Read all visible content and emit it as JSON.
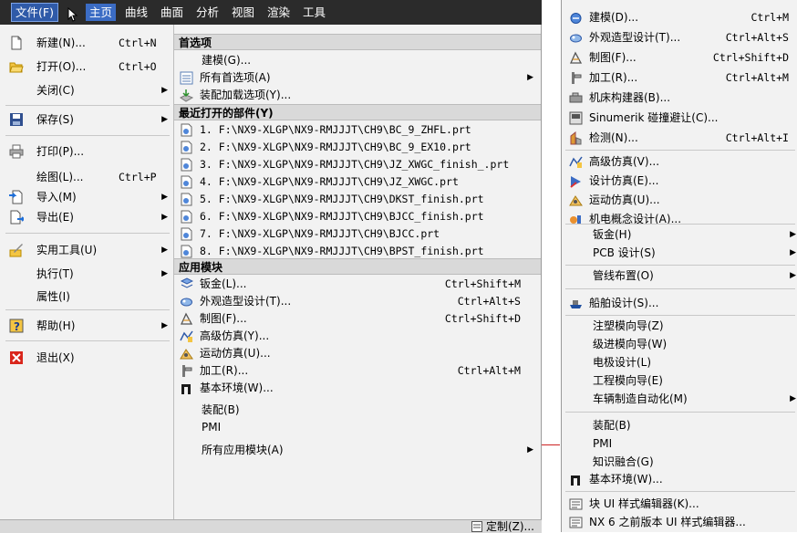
{
  "menubar": {
    "items": [
      "文件(F)",
      "主页",
      "曲线",
      "曲面",
      "分析",
      "视图",
      "渲染",
      "工具"
    ]
  },
  "file_menu": {
    "items": [
      {
        "label": "新建(N)...",
        "shortcut": "Ctrl+N",
        "icon": "new-file-icon"
      },
      {
        "label": "打开(O)...",
        "shortcut": "Ctrl+O",
        "icon": "open-folder-icon"
      },
      {
        "label": "关闭(C)",
        "shortcut": "",
        "icon": ""
      },
      {
        "label": "保存(S)",
        "shortcut": "",
        "icon": "save-icon"
      },
      {
        "label": "打印(P)...",
        "shortcut": "",
        "icon": "print-icon"
      },
      {
        "label": "绘图(L)...",
        "shortcut": "Ctrl+P",
        "icon": ""
      },
      {
        "label": "导入(M)",
        "shortcut": "",
        "icon": "import-icon"
      },
      {
        "label": "导出(E)",
        "shortcut": "",
        "icon": "export-icon"
      },
      {
        "label": "实用工具(U)",
        "shortcut": "",
        "icon": "utilities-icon"
      },
      {
        "label": "执行(T)",
        "shortcut": "",
        "icon": ""
      },
      {
        "label": "属性(I)",
        "shortcut": "",
        "icon": ""
      },
      {
        "label": "帮助(H)",
        "shortcut": "",
        "icon": "help-icon"
      },
      {
        "label": "退出(X)",
        "shortcut": "",
        "icon": "exit-icon"
      }
    ]
  },
  "preferences": {
    "header": "首选项",
    "items": [
      "建模(G)...",
      "所有首选项(A)",
      "装配加载选项(Y)..."
    ]
  },
  "recent": {
    "header": "最近打开的部件(Y)",
    "items": [
      "1. F:\\NX9-XLGP\\NX9-RMJJJT\\CH9\\BC_9_ZHFL.prt",
      "2. F:\\NX9-XLGP\\NX9-RMJJJT\\CH9\\BC_9_EX10.prt",
      "3. F:\\NX9-XLGP\\NX9-RMJJJT\\CH9\\JZ_XWGC_finish_.prt",
      "4. F:\\NX9-XLGP\\NX9-RMJJJT\\CH9\\JZ_XWGC.prt",
      "5. F:\\NX9-XLGP\\NX9-RMJJJT\\CH9\\DKST_finish.prt",
      "6. F:\\NX9-XLGP\\NX9-RMJJJT\\CH9\\BJCC_finish.prt",
      "7. F:\\NX9-XLGP\\NX9-RMJJJT\\CH9\\BJCC.prt",
      "8. F:\\NX9-XLGP\\NX9-RMJJJT\\CH9\\BPST_finish.prt"
    ]
  },
  "app_modules": {
    "header": "应用模块",
    "items": [
      {
        "label": "钣金(L)...",
        "shortcut": "Ctrl+Shift+M"
      },
      {
        "label": "外观造型设计(T)...",
        "shortcut": "Ctrl+Alt+S"
      },
      {
        "label": "制图(F)...",
        "shortcut": "Ctrl+Shift+D"
      },
      {
        "label": "高级仿真(Y)...",
        "shortcut": ""
      },
      {
        "label": "运动仿真(U)...",
        "shortcut": ""
      },
      {
        "label": "加工(R)...",
        "shortcut": "Ctrl+Alt+M"
      },
      {
        "label": "基本环境(W)...",
        "shortcut": ""
      }
    ],
    "assembly": "装配(B)",
    "pmi": "PMI",
    "all_modules": "所有应用模块(A)"
  },
  "bottom": {
    "customize": "定制(Z)..."
  },
  "submenu": {
    "items": [
      {
        "label": "建模(D)...",
        "shortcut": "Ctrl+M",
        "icon": "modeling-icon"
      },
      {
        "label": "外观造型设计(T)...",
        "shortcut": "Ctrl+Alt+S",
        "icon": "shape-studio-icon"
      },
      {
        "label": "制图(F)...",
        "shortcut": "Ctrl+Shift+D",
        "icon": "drafting-icon"
      },
      {
        "label": "加工(R)...",
        "shortcut": "Ctrl+Alt+M",
        "icon": "manufacturing-icon"
      },
      {
        "label": "机床构建器(B)...",
        "shortcut": "",
        "icon": "machine-builder-icon"
      },
      {
        "label": "Sinumerik 碰撞避让(C)...",
        "shortcut": "",
        "icon": "sinumerik-icon"
      },
      {
        "label": "检测(N)...",
        "shortcut": "Ctrl+Alt+I",
        "icon": "inspection-icon"
      },
      {
        "label": "高级仿真(V)...",
        "shortcut": "",
        "icon": "advanced-sim-icon"
      },
      {
        "label": "设计仿真(E)...",
        "shortcut": "",
        "icon": "design-sim-icon"
      },
      {
        "label": "运动仿真(U)...",
        "shortcut": "",
        "icon": "motion-sim-icon"
      },
      {
        "label": "机电概念设计(A)...",
        "shortcut": "",
        "icon": "mechatronics-icon"
      },
      {
        "label": "钣金(H)",
        "shortcut": "",
        "icon": ""
      },
      {
        "label": "PCB 设计(S)",
        "shortcut": "",
        "icon": ""
      },
      {
        "label": "管线布置(O)",
        "shortcut": "",
        "icon": ""
      },
      {
        "label": "船舶设计(S)...",
        "shortcut": "",
        "icon": "ship-design-icon"
      },
      {
        "label": "注塑模向导(Z)",
        "shortcut": "",
        "icon": ""
      },
      {
        "label": "级进模向导(W)",
        "shortcut": "",
        "icon": ""
      },
      {
        "label": "电极设计(L)",
        "shortcut": "",
        "icon": ""
      },
      {
        "label": "工程模向导(E)",
        "shortcut": "",
        "icon": ""
      },
      {
        "label": "车辆制造自动化(M)",
        "shortcut": "",
        "icon": ""
      },
      {
        "label": "装配(B)",
        "shortcut": "",
        "icon": ""
      },
      {
        "label": "PMI",
        "shortcut": "",
        "icon": ""
      },
      {
        "label": "知识融合(G)",
        "shortcut": "",
        "icon": ""
      },
      {
        "label": "基本环境(W)...",
        "shortcut": "",
        "icon": "gateway-icon"
      },
      {
        "label": "块 UI 样式编辑器(K)...",
        "shortcut": "",
        "icon": "block-styler-icon"
      },
      {
        "label": "NX 6 之前版本 UI 样式编辑器...",
        "shortcut": "",
        "icon": "legacy-styler-icon"
      }
    ]
  }
}
